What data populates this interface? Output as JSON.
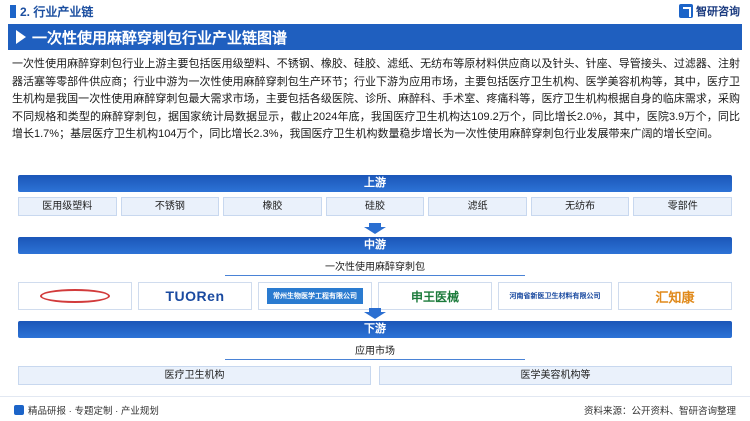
{
  "header": {
    "section": "2. 行业产业链",
    "brand": "智研咨询",
    "title": "一次性使用麻醉穿刺包行业产业链图谱"
  },
  "intro": "一次性使用麻醉穿刺包行业上游主要包括医用级塑料、不锈钢、橡胶、硅胶、滤纸、无纺布等原材料供应商以及针头、针座、导管接头、过滤器、注射器活塞等零部件供应商；行业中游为一次性使用麻醉穿刺包生产环节；行业下游为应用市场，主要包括医疗卫生机构、医学美容机构等，其中，医疗卫生机构是我国一次性使用麻醉穿刺包最大需求市场，主要包括各级医院、诊所、麻醉科、手术室、疼痛科等，医疗卫生机构根据自身的临床需求，采购不同规格和类型的麻醉穿刺包，据国家统计局数据显示，截止2024年底，我国医疗卫生机构达109.2万个，同比增长2.0%，其中，医院3.9万个，同比增长1.7%；基层医疗卫生机构104万个，同比增长2.3%，我国医疗卫生机构数量稳步增长为一次性使用麻醉穿刺包行业发展带来广阔的增长空间。",
  "upstream": {
    "label": "上游",
    "items": [
      "医用级塑料",
      "不锈钢",
      "橡胶",
      "硅胶",
      "滤纸",
      "无纺布",
      "零部件"
    ]
  },
  "midstream": {
    "label": "中游",
    "sub_label": "一次性使用麻醉穿刺包",
    "logos": {
      "l2": "TUORen",
      "l3": "常州生物医学工程有限公司",
      "l4": "申王医械",
      "l5": "河南省新医卫生材料有限公司",
      "l6": "汇知康"
    }
  },
  "downstream": {
    "label": "下游",
    "sub_label": "应用市场",
    "items": [
      "医疗卫生机构",
      "医学美容机构等"
    ]
  },
  "footer": {
    "left": "精品研报 · 专题定制 · 产业规划",
    "source": "资料来源：公开资料、智研咨询整理"
  },
  "colors": {
    "primary": "#1f5fbf",
    "light": "#eaf1fb"
  }
}
